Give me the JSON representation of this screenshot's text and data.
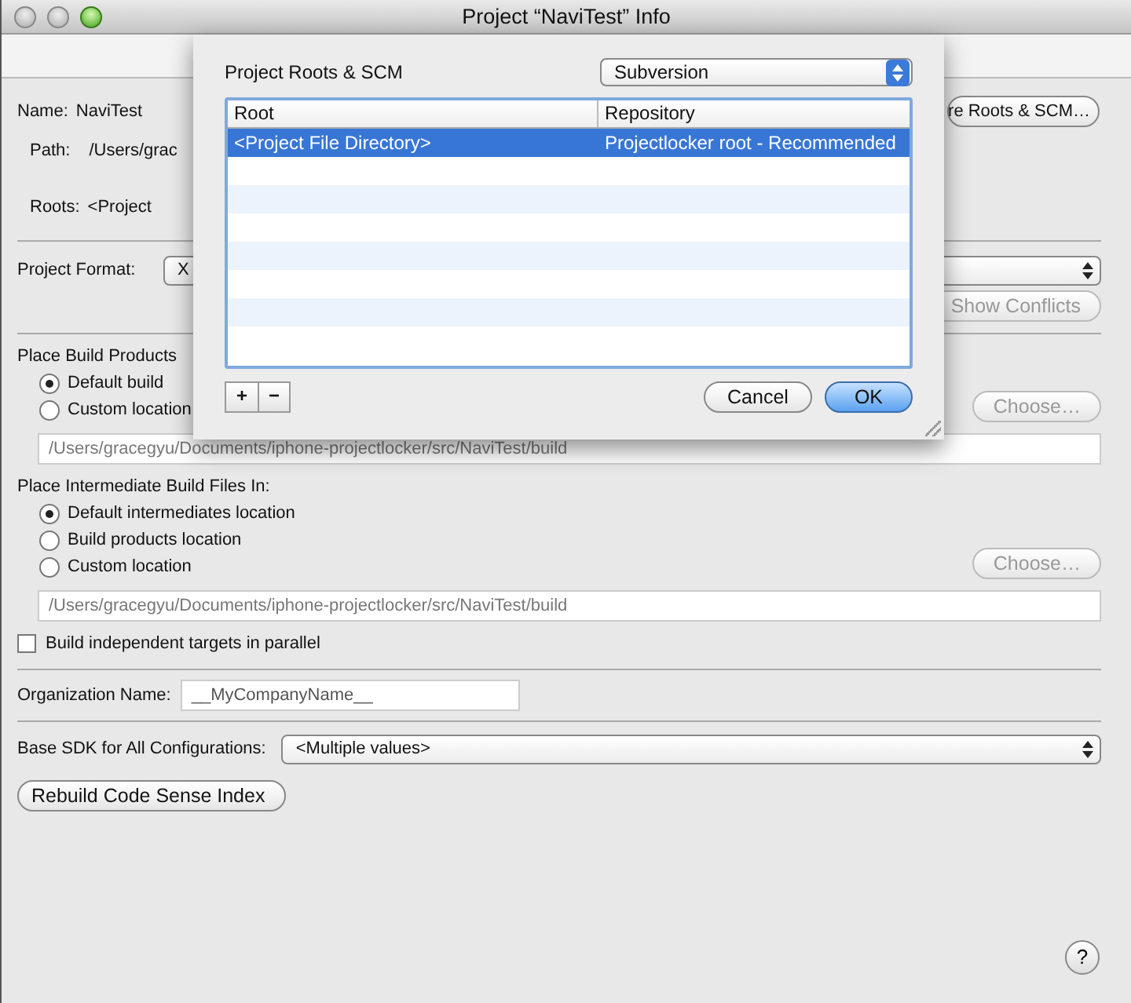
{
  "window": {
    "title": "Project “NaviTest” Info"
  },
  "general": {
    "name_label": "Name:",
    "name_value": "NaviTest",
    "path_label": "Path:",
    "path_value": "/Users/grac",
    "roots_label": "Roots:",
    "roots_value": "<Project",
    "roots_button": "re Roots & SCM…"
  },
  "project_format": {
    "label": "Project Format:",
    "value": "X",
    "conflicts_button": {
      "label": "Show Conflicts",
      "disabled": true
    }
  },
  "build_products": {
    "heading": "Place Build Products",
    "options": [
      {
        "label": "Default build",
        "selected": true
      },
      {
        "label": "Custom location",
        "selected": false
      }
    ],
    "choose_button": {
      "label": "Choose…",
      "disabled": true
    },
    "path": {
      "value": "/Users/gracegyu/Documents/iphone-projectlocker/src/NaviTest/build",
      "disabled": true
    }
  },
  "intermediates": {
    "heading": "Place Intermediate Build Files In:",
    "options": [
      {
        "label": "Default intermediates location",
        "selected": true
      },
      {
        "label": "Build products location",
        "selected": false
      },
      {
        "label": "Custom location",
        "selected": false
      }
    ],
    "choose_button": {
      "label": "Choose…",
      "disabled": true
    },
    "path": {
      "value": "/Users/gracegyu/Documents/iphone-projectlocker/src/NaviTest/build",
      "disabled": true
    }
  },
  "parallel": {
    "label": "Build independent targets in parallel",
    "checked": false
  },
  "organization": {
    "label": "Organization Name:",
    "value": "__MyCompanyName__"
  },
  "base_sdk": {
    "label": "Base SDK for All Configurations:",
    "value": "<Multiple values>"
  },
  "rebuild_button": "Rebuild Code Sense Index",
  "help_button": "?",
  "sheet": {
    "title": "Project Roots & SCM",
    "scm": "Subversion",
    "columns": [
      "Root",
      "Repository"
    ],
    "rows": [
      {
        "root": "<Project File Directory>",
        "repository": "Projectlocker root - Recommended",
        "selected": true
      }
    ],
    "add_button": "+",
    "remove_button": "−",
    "cancel_button": "Cancel",
    "ok_button": "OK"
  }
}
